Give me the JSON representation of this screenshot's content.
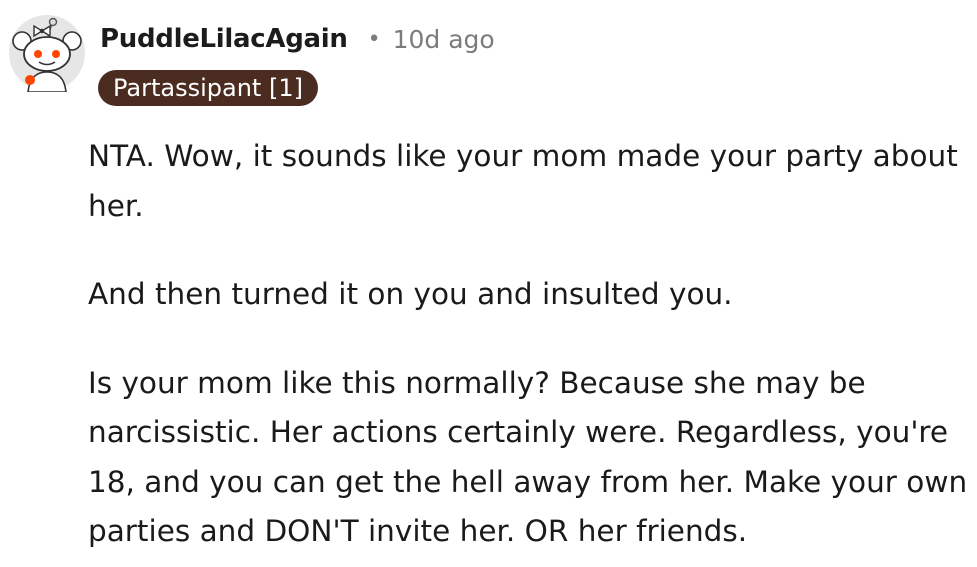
{
  "comment": {
    "username": "PuddleLilacAgain",
    "separator": "•",
    "timestamp": "10d ago",
    "flair": "Partassipant [1]",
    "paragraphs": [
      "NTA. Wow, it sounds like your mom made your party about her.",
      "And then turned it on you and insulted you.",
      "Is your mom like this normally? Because she may be narcissistic. Her actions certainly were. Regardless, you're 18, and you can get the hell away from her. Make your own parties and DON'T invite her. OR her friends."
    ]
  },
  "icons": {
    "avatar": "snoo-avatar-icon"
  },
  "colors": {
    "flair_background": "#4b2c21",
    "flair_text": "#ffffff",
    "username": "#1c1c1c",
    "meta": "#7c7c7c",
    "body_text": "#1a1a1b"
  }
}
